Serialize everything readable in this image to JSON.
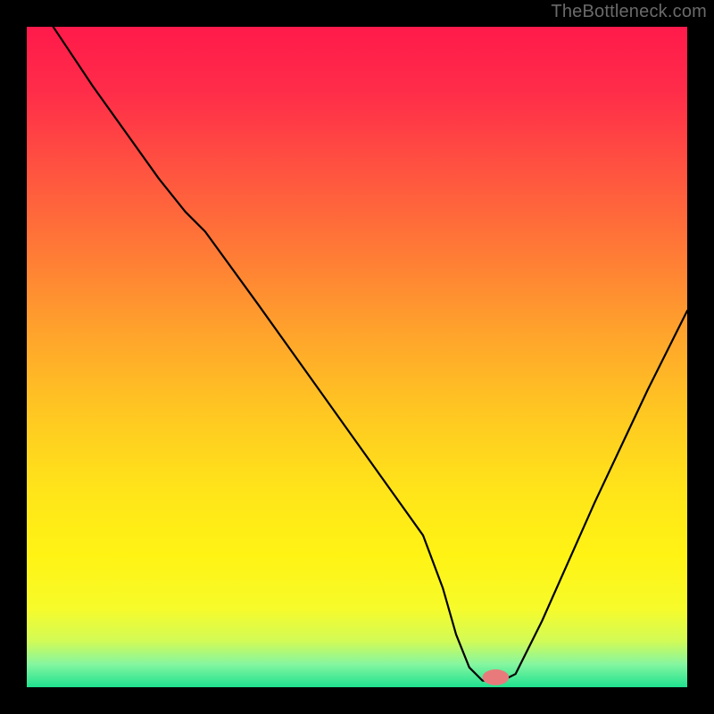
{
  "watermark": "TheBottleneck.com",
  "colors": {
    "frame": "#000000",
    "watermark_text": "#6a6a6a",
    "curve_stroke": "#000000",
    "curve_stroke_width": 2.2,
    "marker_fill": "#e97a7c",
    "gradient_stops": [
      {
        "offset": 0.0,
        "color": "#ff1a4b"
      },
      {
        "offset": 0.1,
        "color": "#ff2d49"
      },
      {
        "offset": 0.22,
        "color": "#ff5440"
      },
      {
        "offset": 0.34,
        "color": "#ff7a36"
      },
      {
        "offset": 0.46,
        "color": "#ffa22c"
      },
      {
        "offset": 0.58,
        "color": "#ffc622"
      },
      {
        "offset": 0.7,
        "color": "#ffe41a"
      },
      {
        "offset": 0.8,
        "color": "#fff314"
      },
      {
        "offset": 0.88,
        "color": "#f7fb2a"
      },
      {
        "offset": 0.93,
        "color": "#d2fb56"
      },
      {
        "offset": 0.965,
        "color": "#86f6a0"
      },
      {
        "offset": 1.0,
        "color": "#1fe18f"
      }
    ]
  },
  "chart_data": {
    "type": "line",
    "title": "",
    "xlabel": "",
    "ylabel": "",
    "xlim": [
      0,
      100
    ],
    "ylim": [
      0,
      100
    ],
    "grid": false,
    "legend": false,
    "annotations": [],
    "series": [
      {
        "name": "curve",
        "x": [
          4.0,
          6.0,
          10.0,
          15.0,
          20.0,
          24.0,
          27.0,
          35.0,
          45.0,
          55.0,
          60.0,
          63.0,
          65.0,
          67.0,
          69.0,
          72.0,
          74.0,
          78.0,
          82.0,
          86.0,
          90.0,
          94.0,
          98.0,
          100.0
        ],
        "values": [
          100.0,
          97.0,
          91.0,
          84.0,
          77.0,
          72.0,
          69.0,
          58.0,
          44.0,
          30.0,
          23.0,
          15.0,
          8.0,
          3.0,
          1.0,
          1.0,
          2.0,
          10.0,
          19.0,
          28.0,
          36.5,
          45.0,
          53.0,
          57.0
        ]
      }
    ],
    "marker": {
      "x": 71,
      "y": 1.5,
      "rx": 2.0,
      "ry": 1.2
    }
  }
}
